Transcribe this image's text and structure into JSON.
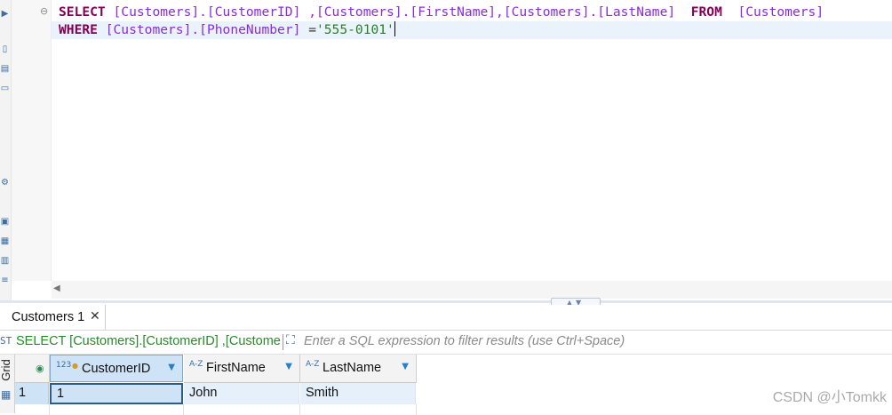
{
  "editor": {
    "line1": {
      "kw_select": "SELECT",
      "p1": "[Customers].[CustomerID]",
      "p2": ",[Customers].[FirstName],[Customers].[LastName]",
      "kw_from": "FROM",
      "p3": "[Customers]"
    },
    "line2": {
      "kw_where": "WHERE",
      "p1": "[Customers].[PhoneNumber]",
      "op": "=",
      "str": "'555-0101'"
    }
  },
  "splitter": {
    "glyphs": "▲▼"
  },
  "results_tab": {
    "label": "Customers 1",
    "close": "✕"
  },
  "filter": {
    "query_preview": "SELECT [Customers].[CustomerID] ,[Customer",
    "placeholder": "Enter a SQL expression to filter results (use Ctrl+Space)"
  },
  "side_tab": {
    "label": "Grid"
  },
  "grid": {
    "columns": [
      {
        "type_badge": "123",
        "label": "CustomerID"
      },
      {
        "type_badge": "A-Z",
        "label": "FirstName"
      },
      {
        "type_badge": "A-Z",
        "label": "LastName"
      }
    ],
    "rows": [
      {
        "num": "1",
        "cells": [
          "1",
          "John",
          "Smith"
        ]
      }
    ]
  },
  "watermark": "CSDN @小Tomkk",
  "colors": {
    "keyword": "#7f0055",
    "identifier": "#8a2be2",
    "string": "#2a7d2a",
    "selection": "#cfe3f7"
  }
}
